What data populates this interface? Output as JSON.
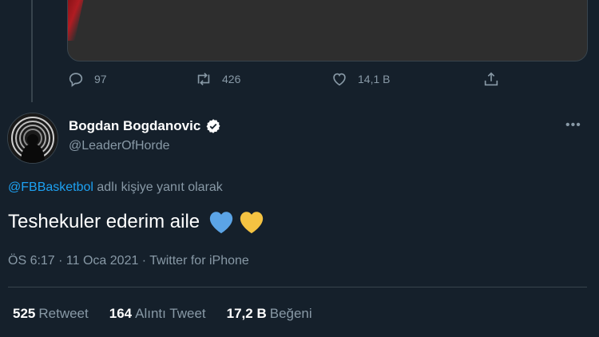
{
  "previous_tweet": {
    "reply_count": "97",
    "retweet_count": "426",
    "like_count": "14,1 B"
  },
  "tweet": {
    "author_name": "Bogdan Bogdanovic",
    "author_handle": "@LeaderOfHorde",
    "reply_to_mention": "@FBBasketbol",
    "reply_to_suffix": " adlı kişiye yanıt olarak",
    "text": "Teshekuler ederim aile",
    "emoji": [
      "blue-heart",
      "yellow-heart"
    ],
    "meta": "ÖS 6:17 · 11 Oca 2021 · Twitter for iPhone",
    "stats": [
      {
        "count": "525",
        "label": "Retweet"
      },
      {
        "count": "164",
        "label": "Alıntı Tweet"
      },
      {
        "count": "17,2 B",
        "label": "Beğeni"
      }
    ]
  },
  "colors": {
    "background": "#15202b",
    "secondary_text": "#8899a6",
    "link": "#1da1f2",
    "border": "#38444d",
    "verified_badge": "#ffffff",
    "blue_heart": "#5ba4e6",
    "yellow_heart": "#f5c342"
  }
}
